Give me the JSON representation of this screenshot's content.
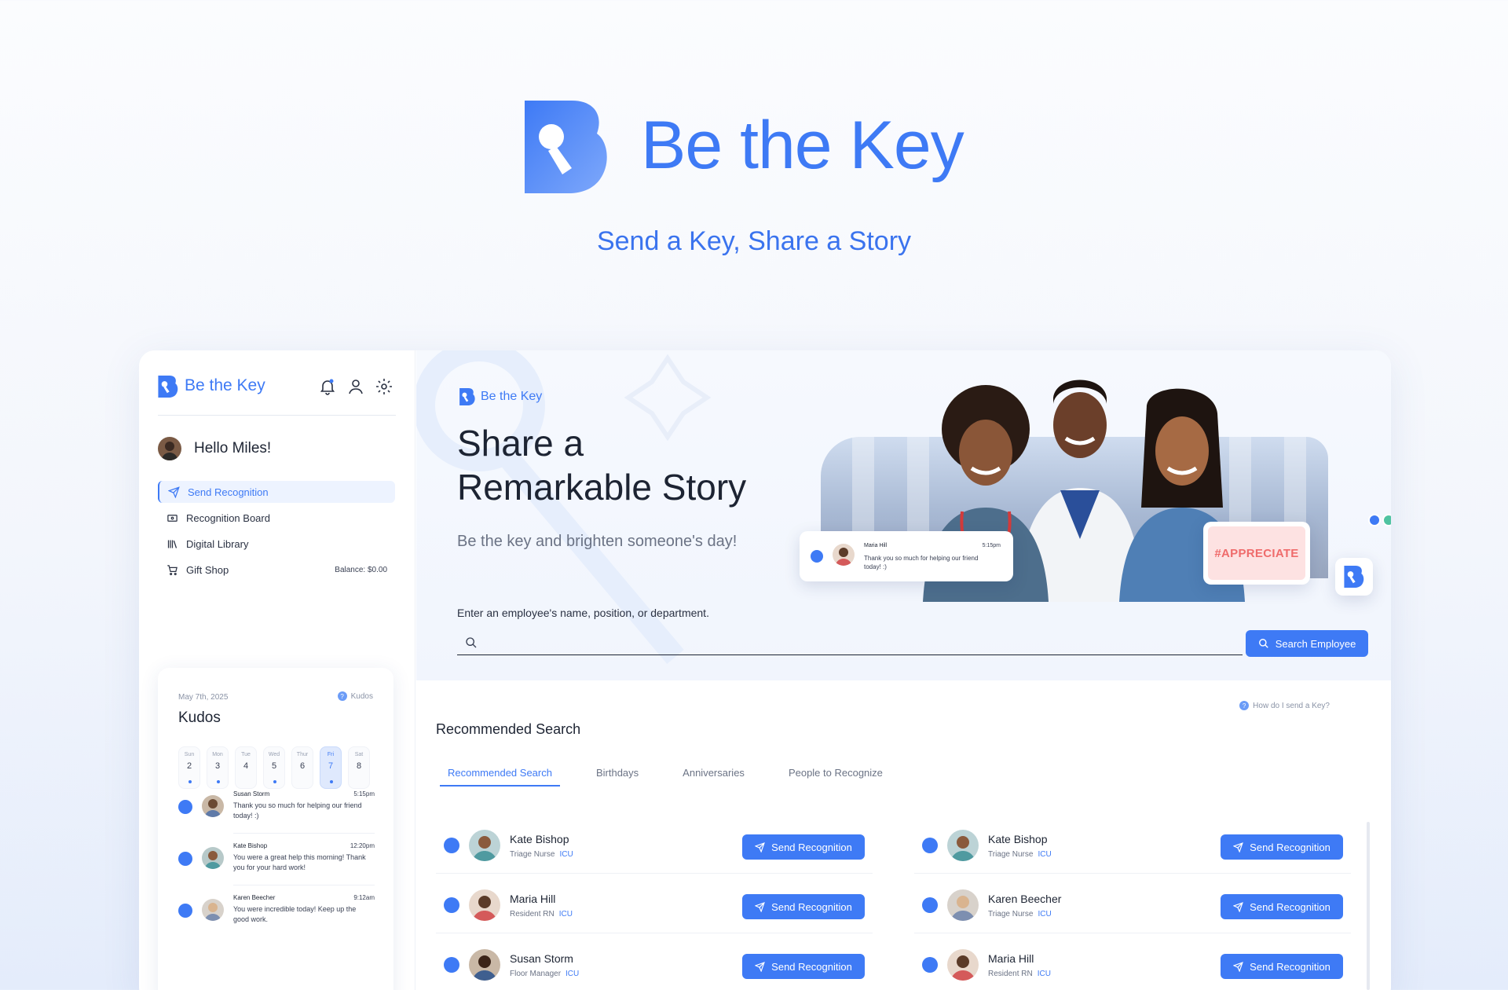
{
  "hero": {
    "brand": "Be the Key",
    "tagline": "Send a Key, Share a Story"
  },
  "sidebar": {
    "brand": "Be the Key",
    "greeting": "Hello Miles!",
    "nav": [
      {
        "label": "Send Recognition",
        "icon": "send-icon",
        "active": true
      },
      {
        "label": "Recognition Board",
        "icon": "board-icon"
      },
      {
        "label": "Digital Library",
        "icon": "library-icon"
      },
      {
        "label": "Gift Shop",
        "icon": "cart-icon",
        "extra": "Balance: $0.00"
      }
    ],
    "kudos": {
      "date": "May 7th, 2025",
      "help": "Kudos",
      "title": "Kudos",
      "days": [
        {
          "name": "Sun",
          "num": "2",
          "dot": true
        },
        {
          "name": "Mon",
          "num": "3",
          "dot": true
        },
        {
          "name": "Tue",
          "num": "4",
          "dot": false
        },
        {
          "name": "Wed",
          "num": "5",
          "dot": true
        },
        {
          "name": "Thur",
          "num": "6",
          "dot": false
        },
        {
          "name": "Fri",
          "num": "7",
          "dot": true,
          "selected": true
        },
        {
          "name": "Sat",
          "num": "8",
          "dot": false
        }
      ],
      "messages": [
        {
          "name": "Susan Storm",
          "time": "5:15pm",
          "text": "Thank you so much for helping our friend today! :)"
        },
        {
          "name": "Kate Bishop",
          "time": "12:20pm",
          "text": "You were a great help this morning! Thank you for your hard work!"
        },
        {
          "name": "Karen Beecher",
          "time": "9:12am",
          "text": "You were incredible today! Keep up the good work."
        }
      ]
    }
  },
  "header": {
    "brand": "Be the Key",
    "title": "Share a Remarkable Story",
    "subtitle": "Be the key and brighten someone's day!",
    "search_label": "Enter an employee's name, position, or department.",
    "search_placeholder": "",
    "search_button": "Search Employee",
    "notification": {
      "name": "Maria Hill",
      "time": "5:15pm",
      "text": "Thank you so much for helping our friend today! :)"
    },
    "badge": "#APPRECIATE"
  },
  "recommended": {
    "help": "How do I send a Key?",
    "title": "Recommended Search",
    "tabs": [
      "Recommended Search",
      "Birthdays",
      "Anniversaries",
      "People to Recognize"
    ],
    "button_label": "Send Recognition",
    "left": [
      {
        "name": "Kate Bishop",
        "role": "Triage Nurse",
        "dept": "ICU"
      },
      {
        "name": "Maria Hill",
        "role": "Resident RN",
        "dept": "ICU"
      },
      {
        "name": "Susan Storm",
        "role": "Floor Manager",
        "dept": "ICU"
      }
    ],
    "right": [
      {
        "name": "Kate Bishop",
        "role": "Triage Nurse",
        "dept": "ICU"
      },
      {
        "name": "Karen Beecher",
        "role": "Triage Nurse",
        "dept": "ICU"
      },
      {
        "name": "Maria Hill",
        "role": "Resident RN",
        "dept": "ICU"
      }
    ]
  },
  "colors": {
    "accent": "#3e7af5",
    "badge_bg": "#fde2e2",
    "badge_text": "#ef6b6b"
  }
}
